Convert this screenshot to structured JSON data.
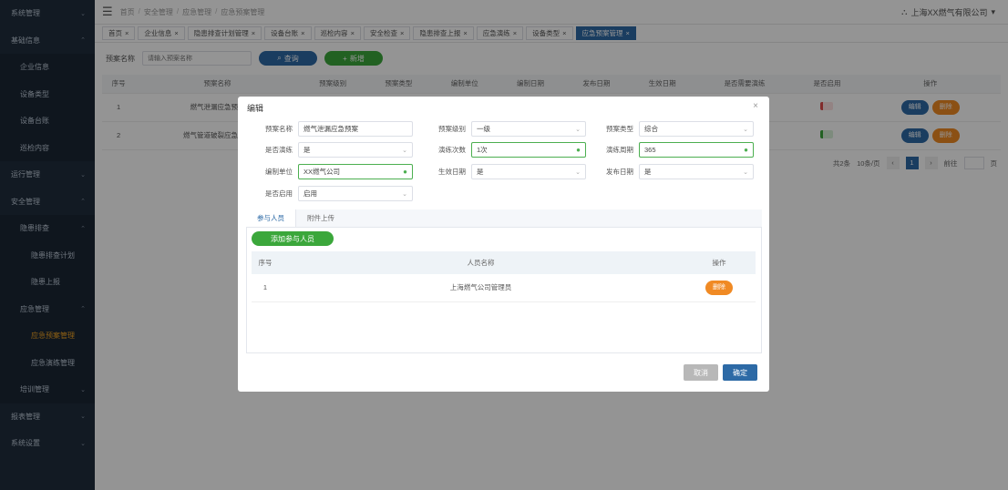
{
  "sidebar": {
    "items": [
      {
        "label": "系统管理",
        "chev": "⌄",
        "kind": "top"
      },
      {
        "label": "基础信息",
        "chev": "⌃",
        "kind": "top"
      },
      {
        "label": "企业信息",
        "chev": "",
        "kind": "sub"
      },
      {
        "label": "设备类型",
        "chev": "",
        "kind": "sub"
      },
      {
        "label": "设备台账",
        "chev": "",
        "kind": "sub"
      },
      {
        "label": "巡检内容",
        "chev": "",
        "kind": "sub"
      },
      {
        "label": "运行管理",
        "chev": "⌄",
        "kind": "top"
      },
      {
        "label": "安全管理",
        "chev": "⌃",
        "kind": "top"
      },
      {
        "label": "隐患排查",
        "chev": "⌃",
        "kind": "sub"
      },
      {
        "label": "隐患排查计划",
        "chev": "",
        "kind": "subsub"
      },
      {
        "label": "隐患上报",
        "chev": "",
        "kind": "subsub"
      },
      {
        "label": "应急管理",
        "chev": "⌃",
        "kind": "sub"
      },
      {
        "label": "应急预案管理",
        "chev": "",
        "kind": "subsub",
        "active": true
      },
      {
        "label": "应急演练管理",
        "chev": "",
        "kind": "subsub"
      },
      {
        "label": "培训管理",
        "chev": "⌄",
        "kind": "sub"
      },
      {
        "label": "报表管理",
        "chev": "⌄",
        "kind": "top"
      },
      {
        "label": "系统设置",
        "chev": "⌄",
        "kind": "top"
      }
    ]
  },
  "topbar": {
    "breadcrumb": [
      "首页",
      "安全管理",
      "应急管理",
      "应急预案管理"
    ],
    "user": "上海XX燃气有限公司"
  },
  "tabs": [
    {
      "label": "首页",
      "active": false
    },
    {
      "label": "企业信息",
      "active": false
    },
    {
      "label": "隐患排查计划管理",
      "active": false
    },
    {
      "label": "设备台账",
      "active": false
    },
    {
      "label": "巡检内容",
      "active": false
    },
    {
      "label": "安全检查",
      "active": false
    },
    {
      "label": "隐患排查上报",
      "active": false
    },
    {
      "label": "应急演练",
      "active": false
    },
    {
      "label": "设备类型",
      "active": false
    },
    {
      "label": "应急预案管理",
      "active": true
    }
  ],
  "search": {
    "label": "预案名称",
    "placeholder": "请输入预案名称",
    "search_btn": "查询",
    "add_btn": "新增"
  },
  "table": {
    "headers": [
      "序号",
      "预案名称",
      "预案级别",
      "预案类型",
      "编制单位",
      "编制日期",
      "发布日期",
      "生效日期",
      "是否需要演练",
      "是否启用",
      "操作"
    ],
    "rows": [
      {
        "no": "1",
        "name": "燃气泄漏应急预案",
        "drill": "red",
        "enabled": "red"
      },
      {
        "no": "2",
        "name": "燃气管道破裂应急预案",
        "drill": "red",
        "enabled": "green"
      }
    ],
    "edit_label": "编辑",
    "delete_label": "删除"
  },
  "pager": {
    "total": "共2条",
    "size": "10条/页",
    "prev": "‹",
    "current": "1",
    "next": "›",
    "goto": "前往",
    "page_unit": "页"
  },
  "dialog": {
    "title": "编辑",
    "close": "×",
    "fields": {
      "plan_name": {
        "label": "预案名称",
        "value": "燃气泄漏应急预案"
      },
      "plan_level": {
        "label": "预案级别",
        "value": "一级"
      },
      "plan_type": {
        "label": "预案类型",
        "value": "综合"
      },
      "need_drill": {
        "label": "是否演练",
        "value": "是"
      },
      "drill_times": {
        "label": "演练次数",
        "value": "1次"
      },
      "drill_cycle": {
        "label": "演练周期",
        "value": "365"
      },
      "org_unit": {
        "label": "编制单位",
        "value": "XX燃气公司"
      },
      "effective": {
        "label": "生效日期",
        "value": "是"
      },
      "publish": {
        "label": "发布日期",
        "value": "是"
      },
      "enabled": {
        "label": "是否启用",
        "value": "启用"
      }
    },
    "tabs": [
      "参与人员",
      "附件上传"
    ],
    "add_person_btn": "添加参与人员",
    "inner_headers": [
      "序号",
      "人员名称",
      "操作"
    ],
    "inner_rows": [
      {
        "no": "1",
        "name": "上海燃气公司管理员"
      }
    ],
    "inner_delete": "删除",
    "cancel_btn": "取消",
    "confirm_btn": "确定"
  },
  "colors": {
    "sidebar_bg": "#1f2d3d",
    "primary": "#2d6aa6",
    "success": "#3ba73b",
    "warning": "#f08a24",
    "active_menu": "#f5a623"
  }
}
